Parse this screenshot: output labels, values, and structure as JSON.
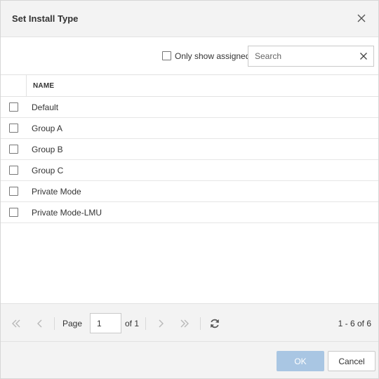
{
  "dialog": {
    "title": "Set Install Type"
  },
  "toolbar": {
    "only_show_assigned_label": "Only show assigned",
    "only_show_assigned_checked": false,
    "search_placeholder": "Search",
    "search_value": ""
  },
  "table": {
    "columns": [
      "NAME"
    ],
    "rows": [
      {
        "name": "Default",
        "checked": false
      },
      {
        "name": "Group A",
        "checked": false
      },
      {
        "name": "Group B",
        "checked": false
      },
      {
        "name": "Group C",
        "checked": false
      },
      {
        "name": "Private Mode",
        "checked": false
      },
      {
        "name": "Private Mode-LMU",
        "checked": false
      }
    ]
  },
  "pager": {
    "page_label": "Page",
    "current_page": "1",
    "of_label": "of 1",
    "range_label": "1 - 6 of 6"
  },
  "footer": {
    "ok_label": "OK",
    "cancel_label": "Cancel"
  },
  "colors": {
    "ok_button_disabled": "#a9c6e3",
    "header_background": "#f3f3f3"
  },
  "icons": [
    "close-icon",
    "search-clear-icon",
    "first-page-icon",
    "prev-page-icon",
    "next-page-icon",
    "last-page-icon",
    "refresh-icon"
  ]
}
